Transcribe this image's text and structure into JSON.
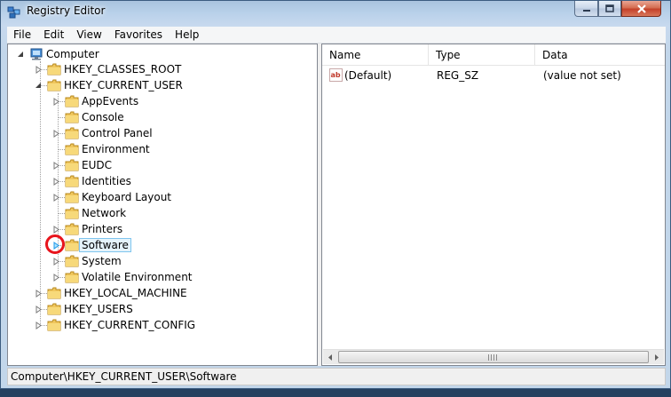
{
  "window": {
    "title": "Registry Editor"
  },
  "menu": [
    "File",
    "Edit",
    "View",
    "Favorites",
    "Help"
  ],
  "tree": {
    "root": "Computer",
    "hives": [
      {
        "label": "HKEY_CLASSES_ROOT"
      },
      {
        "label": "HKEY_CURRENT_USER",
        "expanded": true,
        "children": [
          "AppEvents",
          "Console",
          "Control Panel",
          "Environment",
          "EUDC",
          "Identities",
          "Keyboard Layout",
          "Network",
          "Printers",
          "Software",
          "System",
          "Volatile Environment"
        ]
      },
      {
        "label": "HKEY_LOCAL_MACHINE"
      },
      {
        "label": "HKEY_USERS"
      },
      {
        "label": "HKEY_CURRENT_CONFIG"
      }
    ],
    "selected": "Software"
  },
  "list": {
    "columns": [
      "Name",
      "Type",
      "Data"
    ],
    "rows": [
      {
        "name": "(Default)",
        "type": "REG_SZ",
        "data": "(value not set)"
      }
    ]
  },
  "status": "Computer\\HKEY_CURRENT_USER\\Software",
  "colors": {
    "selection_highlight": "#e5f3fb",
    "annotation_circle": "#e8141c",
    "folder": "#f0c75e"
  }
}
